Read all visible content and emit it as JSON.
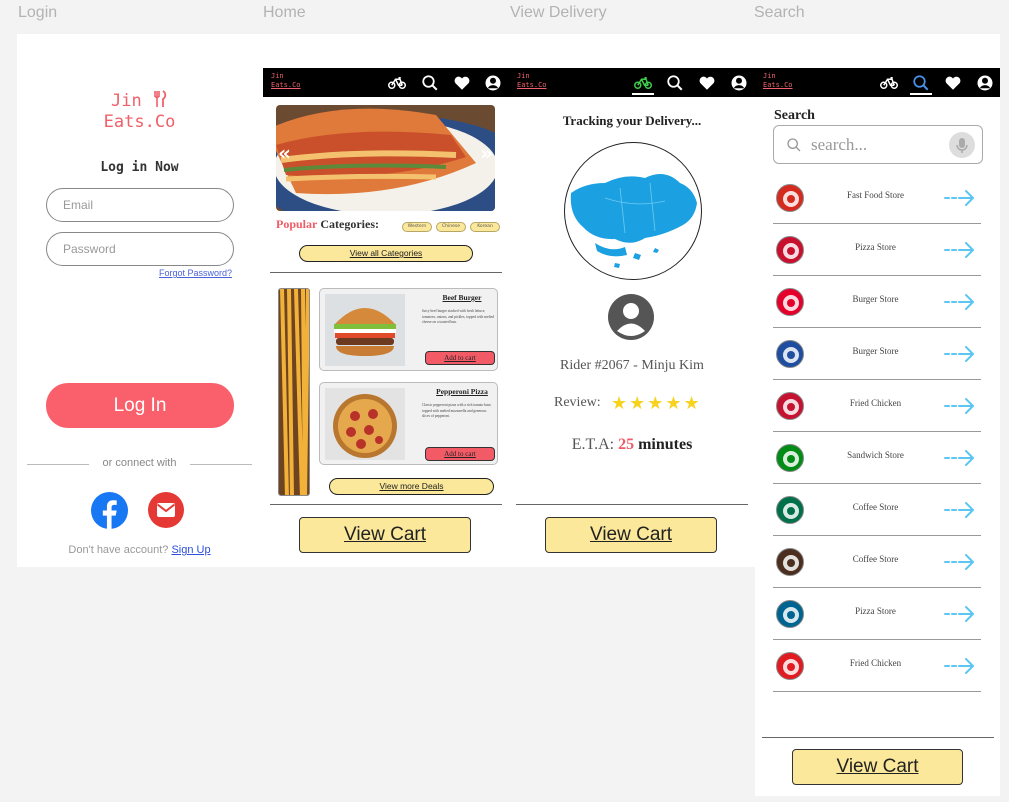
{
  "frames": {
    "login": "Login",
    "home": "Home",
    "delivery": "View Delivery",
    "search": "Search"
  },
  "brand": {
    "line1": "Jin",
    "line2": "Eats.Co"
  },
  "login": {
    "title": "Log in Now",
    "email_placeholder": "Email",
    "password_placeholder": "Password",
    "forgot": "Forgot Password?",
    "button": "Log In",
    "connect": "or connect with",
    "no_account": "Don't have account?",
    "signup": "Sign Up"
  },
  "home": {
    "popular_word": "Popular",
    "categories_word": " Categories:",
    "chips": [
      "Western",
      "Chinese",
      "Korean"
    ],
    "view_all": "View all Categories",
    "deals": [
      {
        "title": "Beef Burger",
        "desc": "Juicy beef burger stacked with fresh lettuce, tomatoes, onions, and pickles, topped with melted cheese on a toasted bun.",
        "button": "Add to cart"
      },
      {
        "title": "Pepperoni Pizza",
        "desc": "Classic pepperoni pizza with a rich tomato base, topped with melted mozzarella and generous slices of pepperoni.",
        "button": "Add to cart"
      }
    ],
    "view_more": "View more Deals",
    "view_cart": "View Cart"
  },
  "delivery": {
    "title": "Tracking your Delivery...",
    "rider": "Rider #2067 - Minju Kim",
    "review_label": "Review:",
    "rating": 5,
    "stars": "★★★★★",
    "eta_label": "E.T.A:",
    "eta_value": "25",
    "eta_unit": " minutes",
    "view_cart": "View Cart"
  },
  "search": {
    "title": "Search",
    "placeholder": "search...",
    "stores": [
      {
        "name": "Fast Food Store",
        "icon": "mcdonalds-logo",
        "color": "#d52b1e"
      },
      {
        "name": "Pizza Store",
        "icon": "pizza-hut-logo",
        "color": "#c8102e"
      },
      {
        "name": "Burger Store",
        "icon": "mos-burger-logo",
        "color": "#e4002b"
      },
      {
        "name": "Burger Store",
        "icon": "burger-king-logo",
        "color": "#1f4ea1"
      },
      {
        "name": "Fried Chicken",
        "icon": "kfc-logo",
        "color": "#c41230"
      },
      {
        "name": "Sandwich Store",
        "icon": "subway-logo",
        "color": "#008c15"
      },
      {
        "name": "Coffee Store",
        "icon": "starbucks-logo",
        "color": "#00704a"
      },
      {
        "name": "Coffee Store",
        "icon": "coffee-bean-logo",
        "color": "#4b2e1e"
      },
      {
        "name": "Pizza Store",
        "icon": "dominos-logo",
        "color": "#006491"
      },
      {
        "name": "Fried Chicken",
        "icon": "jollibee-logo",
        "color": "#e11b22"
      }
    ],
    "view_cart": "View Cart"
  }
}
